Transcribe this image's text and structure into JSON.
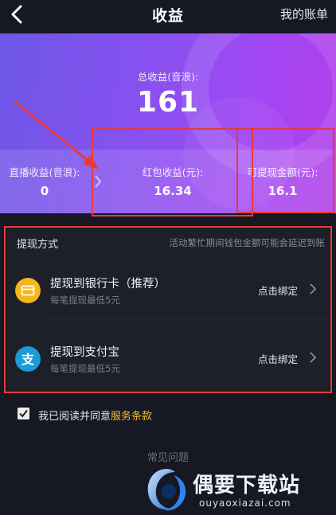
{
  "header": {
    "title": "收益",
    "bill_label": "我的账单"
  },
  "summary": {
    "total_label": "总收益(音浪):",
    "total_value": "161",
    "stats": [
      {
        "label": "直播收益(音浪):",
        "value": "0"
      },
      {
        "label": "红包收益(元):",
        "value": "16.34"
      },
      {
        "label": "可提现金额(元):",
        "value": "16.1"
      }
    ]
  },
  "withdraw": {
    "title": "提现方式",
    "note": "活动繁忙期间钱包金额可能会延迟到账",
    "methods": [
      {
        "name": "提现到银行卡（推荐）",
        "sub": "每笔提现最低5元",
        "action": "点击绑定",
        "icon": "bank-card-icon",
        "icon_color": "#f5b81a"
      },
      {
        "name": "提现到支付宝",
        "sub": "每笔提现最低5元",
        "action": "点击绑定",
        "icon": "alipay-icon",
        "icon_color": "#1c9bd8"
      }
    ]
  },
  "agreement": {
    "prefix": "我已阅读并同意",
    "link": "服务条款",
    "checked": true
  },
  "faq_label": "常见问题",
  "watermark": {
    "name": "偶要下载站",
    "url": "ouyaoxiazai.com"
  },
  "colors": {
    "background": "#161823",
    "accent": "#f2c030",
    "annotation": "#e53b3b"
  }
}
